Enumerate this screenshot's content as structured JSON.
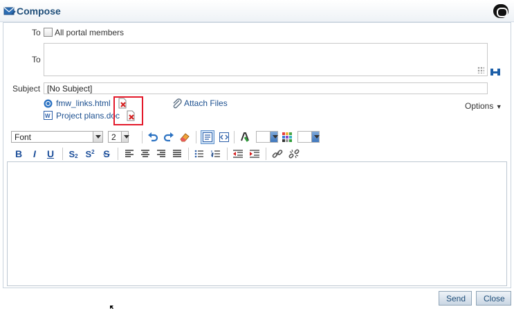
{
  "dialog": {
    "title": "Compose"
  },
  "to": {
    "label": "To",
    "all_members_label": "All portal members",
    "label2": "To",
    "value": ""
  },
  "subject": {
    "label": "Subject",
    "value": "[No Subject]"
  },
  "attachments": [
    {
      "name": "fmw_links.html",
      "icon": "html-file-icon"
    },
    {
      "name": "Project plans.doc",
      "icon": "word-doc-icon"
    }
  ],
  "attach_files_label": "Attach Files",
  "options_label": "Options",
  "toolbar": {
    "font": "Font",
    "font_size": "2"
  },
  "buttons": {
    "send": "Send",
    "close": "Close"
  },
  "colors": {
    "accent": "#1f4e79",
    "highlight": "#e3192a"
  }
}
